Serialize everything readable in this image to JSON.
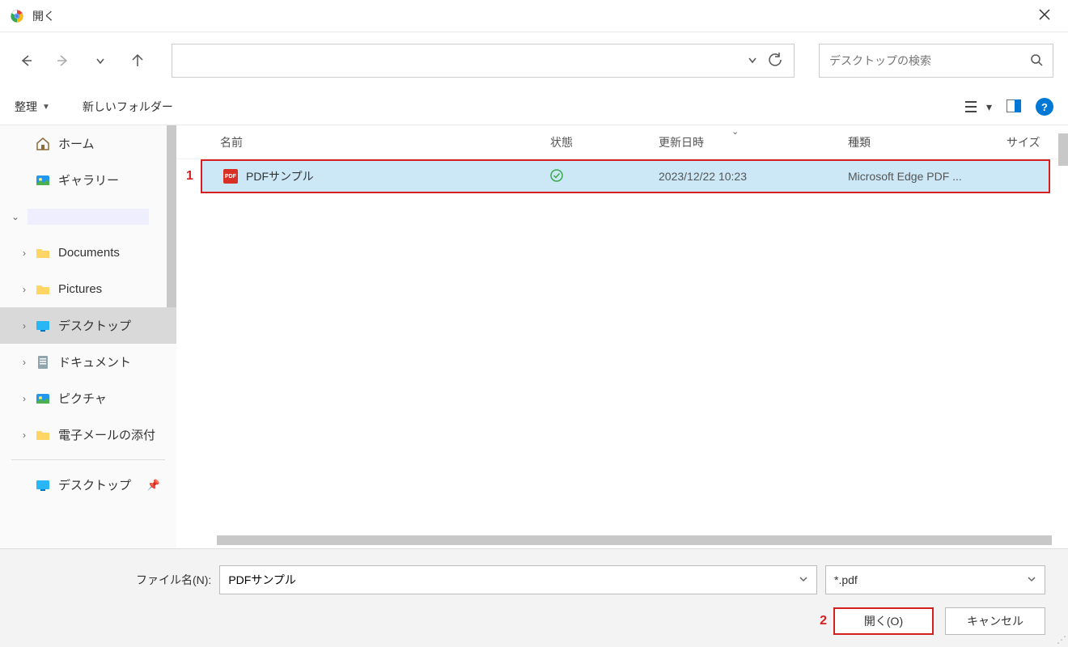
{
  "window": {
    "title": "開く"
  },
  "toolbar": {
    "organize": "整理",
    "new_folder": "新しいフォルダー"
  },
  "search": {
    "placeholder": "デスクトップの検索"
  },
  "sidebar": {
    "home": "ホーム",
    "gallery": "ギャラリー",
    "documents": "Documents",
    "pictures": "Pictures",
    "desktop": "デスクトップ",
    "documents_jp": "ドキュメント",
    "pictures_jp": "ピクチャ",
    "email_attach": "電子メールの添付",
    "desktop_bottom": "デスクトップ"
  },
  "columns": {
    "name": "名前",
    "status": "状態",
    "date": "更新日時",
    "type": "種類",
    "size": "サイズ"
  },
  "files": [
    {
      "name": "PDFサンプル",
      "date": "2023/12/22 10:23",
      "type": "Microsoft Edge PDF ..."
    }
  ],
  "bottom": {
    "filename_label": "ファイル名(N):",
    "filename_value": "PDFサンプル",
    "filter": "*.pdf",
    "open_btn": "開く(O)",
    "cancel_btn": "キャンセル"
  },
  "annotations": {
    "a1": "1",
    "a2": "2"
  }
}
